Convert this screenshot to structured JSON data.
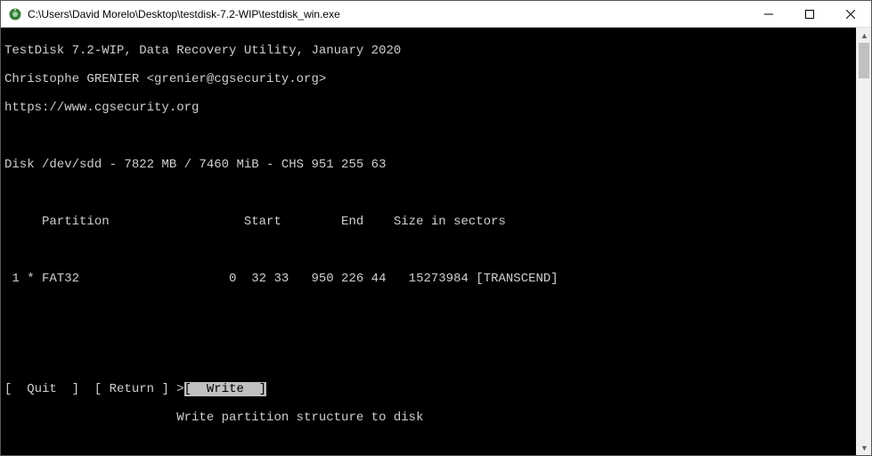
{
  "titlebar": {
    "path": "C:\\Users\\David Morelo\\Desktop\\testdisk-7.2-WIP\\testdisk_win.exe"
  },
  "header": {
    "line1": "TestDisk 7.2-WIP, Data Recovery Utility, January 2020",
    "line2": "Christophe GRENIER <grenier@cgsecurity.org>",
    "line3": "https://www.cgsecurity.org"
  },
  "disk_line": "Disk /dev/sdd - 7822 MB / 7460 MiB - CHS 951 255 63",
  "columns_line": "     Partition                  Start        End    Size in sectors",
  "partition_row": " 1 * FAT32                    0  32 33   950 226 44   15273984 [TRANSCEND]",
  "menu": {
    "quit": "[  Quit  ]",
    "return": "[ Return ]",
    "write_marker": ">",
    "write": "[  Write  ]"
  },
  "hint": "                       Write partition structure to disk"
}
